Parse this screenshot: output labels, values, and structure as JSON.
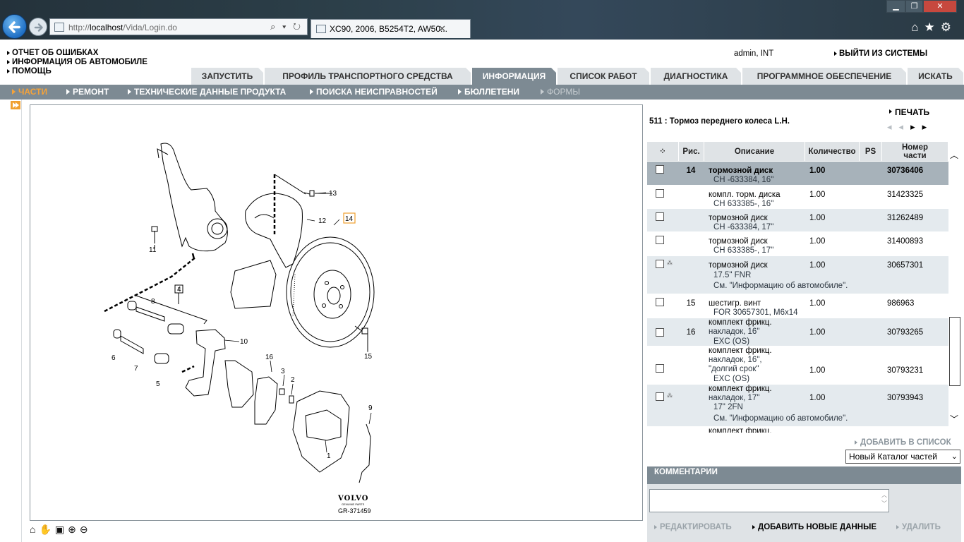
{
  "browser": {
    "url_prefix": "http://",
    "url_host": "localhost",
    "url_path": "/Vida/Login.do",
    "tab_title": "XC90, 2006, B5254T2, AW50...",
    "address_tools": "⌕ ▾ ↻",
    "icons": [
      "back-arrow-icon",
      "forward-arrow-icon",
      "home-icon",
      "star-icon",
      "gear-icon"
    ]
  },
  "header": {
    "menu": [
      "ОТЧЕТ ОБ ОШИБКАХ",
      "ИНФОРМАЦИЯ ОБ АВТОМОБИЛЕ",
      "ПОМОЩЬ"
    ],
    "user": "admin, INT",
    "logout": "ВЫЙТИ ИЗ СИСТЕМЫ"
  },
  "main_tabs": [
    {
      "label": "ЗАПУСТИТЬ",
      "active": false
    },
    {
      "label": "ПРОФИЛЬ ТРАНСПОРТНОГО СРЕДСТВА",
      "active": false
    },
    {
      "label": "ИНФОРМАЦИЯ",
      "active": true
    },
    {
      "label": "СПИСОК РАБОТ",
      "active": false
    },
    {
      "label": "ДИАГНОСТИКА",
      "active": false
    },
    {
      "label": "ПРОГРАММНОЕ ОБЕСПЕЧЕНИЕ",
      "active": false
    },
    {
      "label": "ИСКАТЬ",
      "active": false
    }
  ],
  "sub_tabs": [
    {
      "label": "ЧАСТИ",
      "state": "active"
    },
    {
      "label": "РЕМОНТ",
      "state": "normal"
    },
    {
      "label": "ТЕХНИЧЕСКИЕ ДАННЫЕ ПРОДУКТА",
      "state": "normal"
    },
    {
      "label": "ПОИСКА НЕИСПРАВНОСТЕЙ",
      "state": "normal"
    },
    {
      "label": "БЮЛЛЕТЕНИ",
      "state": "normal"
    },
    {
      "label": "ФОРМЫ",
      "state": "disabled"
    }
  ],
  "diagram": {
    "callouts": [
      "1",
      "2",
      "3",
      "4",
      "5",
      "6",
      "7",
      "8",
      "9",
      "10",
      "11",
      "12",
      "13",
      "14",
      "15",
      "16"
    ],
    "highlighted_callout": "14",
    "brand": "VOLVO",
    "brand_sub": "GENUINE PARTS",
    "code": "GR-371459",
    "tools": [
      "home-icon",
      "hand-pan-icon",
      "fit-page-icon",
      "zoom-in-icon",
      "zoom-out-icon"
    ]
  },
  "panel": {
    "print": "ПЕЧАТЬ",
    "title": "511 : Тормоз переднего колеса L.H.",
    "columns": {
      "pos": "Рис.",
      "desc": "Описание",
      "qty": "Количество",
      "ps": "PS",
      "pno": "Номер части"
    },
    "rows": [
      {
        "pos": "14",
        "desc": "тормозной диск",
        "sub": [
          "CH -633384, 16\""
        ],
        "qty": "1.00",
        "pno": "30736406",
        "star": false,
        "selected": true
      },
      {
        "pos": "",
        "desc": "компл. торм. диска",
        "sub": [
          "CH 633385-, 16\""
        ],
        "qty": "1.00",
        "pno": "31423325",
        "star": false,
        "selected": false
      },
      {
        "pos": "",
        "desc": "тормозной диск",
        "sub": [
          "CH -633384, 17\""
        ],
        "qty": "1.00",
        "pno": "31262489",
        "star": false,
        "selected": false
      },
      {
        "pos": "",
        "desc": "тормозной диск",
        "sub": [
          "CH 633385-, 17\""
        ],
        "qty": "1.00",
        "pno": "31400893",
        "star": false,
        "selected": false
      },
      {
        "pos": "",
        "desc": "тормозной диск",
        "sub": [
          "17.5\" FNR",
          "См. \"Информацию об автомобиле\"."
        ],
        "qty": "1.00",
        "pno": "30657301",
        "star": true,
        "selected": false
      },
      {
        "pos": "15",
        "desc": "шестигр. винт",
        "sub": [
          "FOR 30657301, M6x14"
        ],
        "qty": "1.00",
        "pno": "986963",
        "star": false,
        "selected": false
      },
      {
        "pos": "16",
        "desc": "комплект фрикц.",
        "sub": [
          "накладок, 16\"",
          "EXC (OS)"
        ],
        "qty": "1.00",
        "pno": "30793265",
        "star": false,
        "selected": false
      },
      {
        "pos": "",
        "desc": "комплект фрикц.",
        "sub": [
          "накладок, 16\",",
          "\"долгий срок\"",
          "EXC (OS)"
        ],
        "qty": "1.00",
        "pno": "30793231",
        "star": false,
        "selected": false
      },
      {
        "pos": "",
        "desc": "комплект фрикц.",
        "sub": [
          "накладок, 17\"",
          "17\" 2FN",
          "См. \"Информацию об автомобиле\"."
        ],
        "qty": "1.00",
        "pno": "30793943",
        "star": true,
        "selected": false
      },
      {
        "pos": "",
        "desc": "комплект фрикц.",
        "sub": [],
        "qty": "",
        "pno": "",
        "star": false,
        "selected": false
      }
    ],
    "add_to_list": "ДОБАВИТЬ В СПИСОК",
    "catalog_select": "Новый Каталог частей",
    "comments": {
      "title": "КОММЕНТАРИИ",
      "edit": "РЕДАКТИРОВАТЬ",
      "add": "ДОБАВИТЬ НОВЫЕ ДАННЫЕ",
      "delete": "УДАЛИТЬ"
    }
  }
}
